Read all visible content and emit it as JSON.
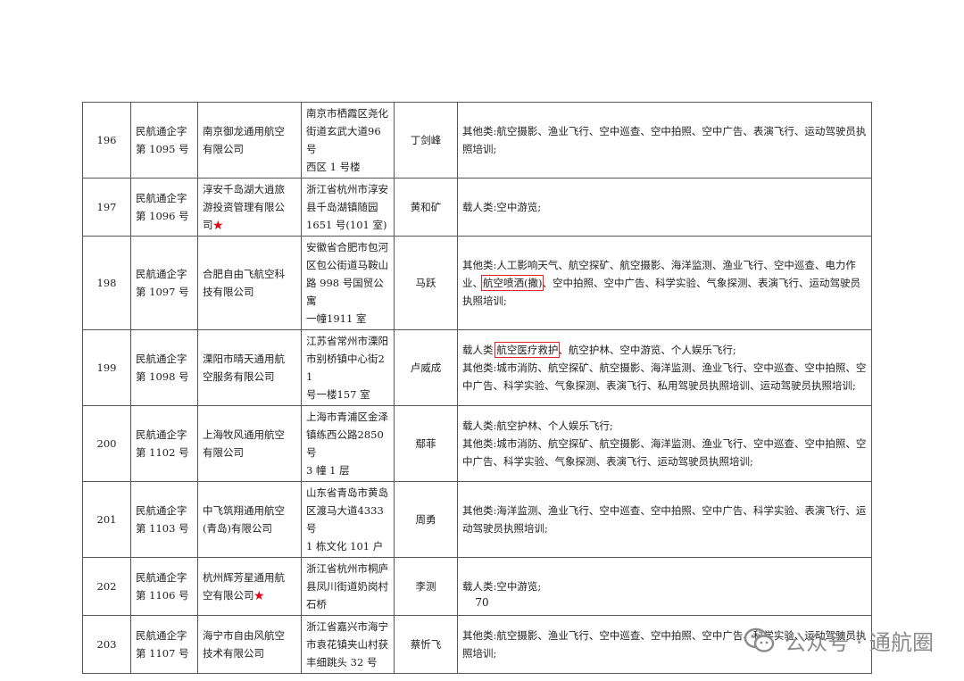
{
  "rows": [
    {
      "no": "196",
      "permit": [
        "民航通企字",
        "第 1095 号"
      ],
      "company": [
        "南京御龙通用航空",
        "有限公司"
      ],
      "star": "",
      "address": [
        "南京市栖霞区尧化",
        "街道玄武大道96号",
        "西区 1 号楼"
      ],
      "operator": "丁剑峰",
      "scope": [
        {
          "text": "其他类:航空摄影、渔业飞行、空中巡查、空中拍照、空中广告、表演飞行、运动驾驶员执照培训;"
        }
      ]
    },
    {
      "no": "197",
      "permit": [
        "民航通企字",
        "第 1096 号"
      ],
      "company": [
        "淳安千岛湖大逍旅",
        "游投资管理有限公",
        "司"
      ],
      "star": "★",
      "address": [
        "浙江省杭州市淳安",
        "县千岛湖镇随园",
        "1651 号(101 室)"
      ],
      "operator": "黄和矿",
      "scope": [
        {
          "text": "载人类:空中游览;"
        }
      ]
    },
    {
      "no": "198",
      "permit": [
        "民航通企字",
        "第 1097 号"
      ],
      "company": [
        "合肥自由飞航空科",
        "技有限公司"
      ],
      "star": "",
      "address": [
        "安徽省合肥市包河",
        "区包公街道马鞍山",
        "路 998 号国贸公寓",
        "一幢1911 室"
      ],
      "operator": "马跃",
      "scope": [
        {
          "text": "其他类:人工影响天气、航空探矿、航空摄影、海洋监测、渔业飞行、空中巡查、电力作业、",
          "boxed": "航空喷洒(撒)",
          "after": "、空中拍照、空中广告、科学实验、气象探测、表演飞行、运动驾驶员执照培训;"
        }
      ]
    },
    {
      "no": "199",
      "permit": [
        "民航通企字",
        "第 1098 号"
      ],
      "company": [
        "溧阳市晴天通用航",
        "空服务有限公司"
      ],
      "star": "",
      "address": [
        "江苏省常州市溧阳",
        "市别桥镇中心街21",
        "号一楼157 室"
      ],
      "operator": "卢威成",
      "scope": [
        {
          "text": "载人类:",
          "boxed": "航空医疗救护",
          "after": "、航空护林、空中游览、个人娱乐飞行;"
        },
        {
          "text": "其他类:城市消防、航空探矿、航空摄影、海洋监测、渔业飞行、空中巡查、空中拍照、空中广告、科学实验、气象探测、表演飞行、私用驾驶员执照培训、运动驾驶员执照培训;"
        }
      ]
    },
    {
      "no": "200",
      "permit": [
        "民航通企字",
        "第 1102 号"
      ],
      "company": [
        "上海牧风通用航空",
        "有限公司"
      ],
      "star": "",
      "address": [
        "上海市青浦区金泽",
        "镇练西公路2850号",
        "3 幢 1 层"
      ],
      "operator": "鄢菲",
      "scope": [
        {
          "text": "载人类:航空护林、个人娱乐飞行;"
        },
        {
          "text": "其他类:城市消防、航空探矿、航空摄影、海洋监测、渔业飞行、空中巡查、空中拍照、空中广告、科学实验、气象探测、表演飞行、运动驾驶员执照培训;"
        }
      ]
    },
    {
      "no": "201",
      "permit": [
        "民航通企字",
        "第 1103 号"
      ],
      "company": [
        "中飞筑翔通用航空",
        "(青岛)有限公司"
      ],
      "star": "",
      "address": [
        "山东省青岛市黄岛",
        "区渡马大道4333 号",
        "1 栋文化 101 户"
      ],
      "operator": "周勇",
      "scope": [
        {
          "text": "其他类:海洋监测、渔业飞行、空中巡查、空中拍照、空中广告、科学实验、表演飞行、运动驾驶员执照培训;"
        }
      ]
    },
    {
      "no": "202",
      "permit": [
        "民航通企字",
        "第 1106 号"
      ],
      "company": [
        "杭州辉芳星通用航",
        "空有限公司"
      ],
      "star": "★",
      "address": [
        "浙江省杭州市桐庐",
        "县凤川街道奶岗村",
        "石桥"
      ],
      "operator": "李测",
      "scope": [
        {
          "text": "载人类:空中游览;"
        }
      ]
    },
    {
      "no": "203",
      "permit": [
        "民航通企字",
        "第 1107 号"
      ],
      "company": [
        "海宁市自由风航空",
        "技术有限公司"
      ],
      "star": "",
      "address": [
        "浙江省嘉兴市海宁",
        "市袁花镇夹山村获",
        "丰细跳头 32 号"
      ],
      "operator": "蔡忻飞",
      "scope": [
        {
          "text": "其他类:航空摄影、渔业飞行、空中巡查、空中拍照、空中广告、科学实验、运动驾驶员执照培训;"
        }
      ]
    }
  ],
  "page_number": "70",
  "watermark": {
    "text": "公众号 · 通航圈",
    "icon": "wechat-icon"
  }
}
